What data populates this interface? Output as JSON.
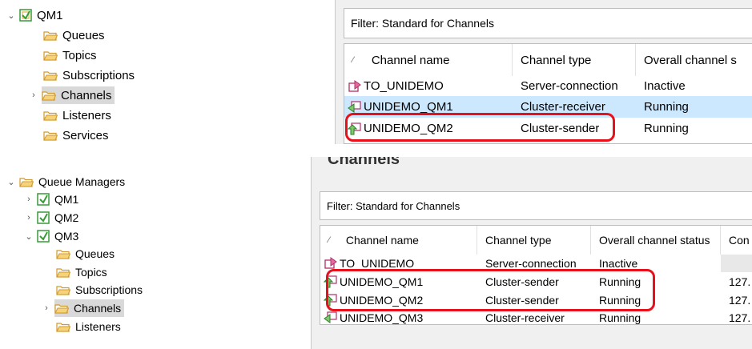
{
  "top_tree": {
    "root_label": "QM1",
    "items": [
      {
        "label": "Queues",
        "selected": false
      },
      {
        "label": "Topics",
        "selected": false
      },
      {
        "label": "Subscriptions",
        "selected": false
      },
      {
        "label": "Channels",
        "selected": true
      },
      {
        "label": "Listeners",
        "selected": false
      },
      {
        "label": "Services",
        "selected": false
      }
    ]
  },
  "top_panel": {
    "filter_label": "Filter:  Standard for Channels",
    "columns": [
      "Channel name",
      "Channel type",
      "Overall channel s"
    ],
    "rows": [
      {
        "name": "TO_UNIDEMO",
        "type": "Server-connection",
        "status": "Inactive",
        "icon": "server-connection-channel-icon",
        "selected": false
      },
      {
        "name": "UNIDEMO_QM1",
        "type": "Cluster-receiver",
        "status": "Running",
        "icon": "cluster-receiver-channel-icon",
        "selected": true
      },
      {
        "name": "UNIDEMO_QM2",
        "type": "Cluster-sender",
        "status": "Running",
        "icon": "cluster-sender-channel-icon",
        "selected": false
      }
    ]
  },
  "bottom_tree": {
    "root_label": "Queue Managers",
    "qmgrs": [
      {
        "label": "QM1",
        "expanded": false
      },
      {
        "label": "QM2",
        "expanded": false
      },
      {
        "label": "QM3",
        "expanded": true
      }
    ],
    "items": [
      {
        "label": "Queues",
        "selected": false
      },
      {
        "label": "Topics",
        "selected": false
      },
      {
        "label": "Subscriptions",
        "selected": false
      },
      {
        "label": "Channels",
        "selected": true
      },
      {
        "label": "Listeners",
        "selected": false
      }
    ]
  },
  "bottom_panel": {
    "heading": "Channels",
    "filter_label": "Filter:  Standard for Channels",
    "columns": [
      "Channel name",
      "Channel type",
      "Overall channel status",
      "Con"
    ],
    "rows": [
      {
        "name": "TO_UNIDEMO",
        "type": "Server-connection",
        "status": "Inactive",
        "conn": "",
        "icon": "server-connection-channel-icon"
      },
      {
        "name": "UNIDEMO_QM1",
        "type": "Cluster-sender",
        "status": "Running",
        "conn": "127.",
        "icon": "cluster-sender-channel-icon"
      },
      {
        "name": "UNIDEMO_QM2",
        "type": "Cluster-sender",
        "status": "Running",
        "conn": "127.",
        "icon": "cluster-sender-channel-icon"
      },
      {
        "name": "UNIDEMO_QM3",
        "type": "Cluster-receiver",
        "status": "Running",
        "conn": "127.",
        "icon": "cluster-receiver-channel-icon"
      }
    ]
  },
  "colors": {
    "highlight": "#e8101a",
    "selection": "#cce8ff",
    "folder": "#e8b84a",
    "qmgr": "#3a9a3a"
  }
}
